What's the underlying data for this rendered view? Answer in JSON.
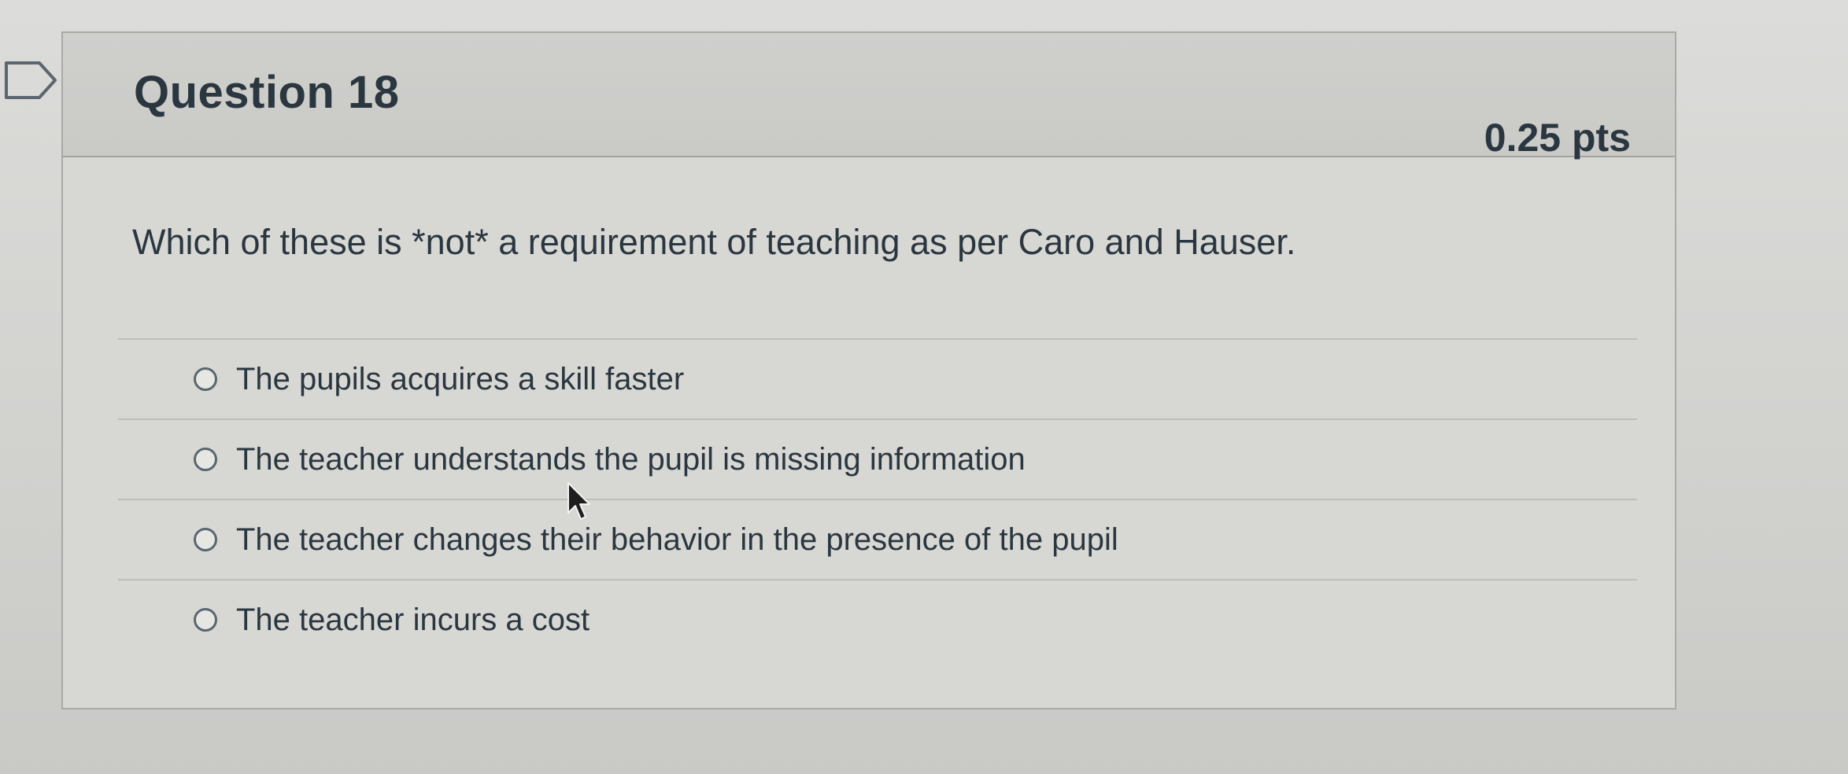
{
  "question": {
    "title": "Question 18",
    "points": "0.25 pts",
    "text": "Which of these is *not* a requirement of teaching as per Caro and Hauser.",
    "answers": [
      {
        "label": "The pupils acquires a skill faster",
        "selected": false
      },
      {
        "label": "The teacher understands the pupil is missing information",
        "selected": false
      },
      {
        "label": "The teacher changes their behavior in the presence of the pupil",
        "selected": false
      },
      {
        "label": "The teacher incurs a cost",
        "selected": false
      }
    ]
  },
  "icons": {
    "flag": "flag-outline-icon",
    "cursor": "mouse-pointer-icon"
  }
}
